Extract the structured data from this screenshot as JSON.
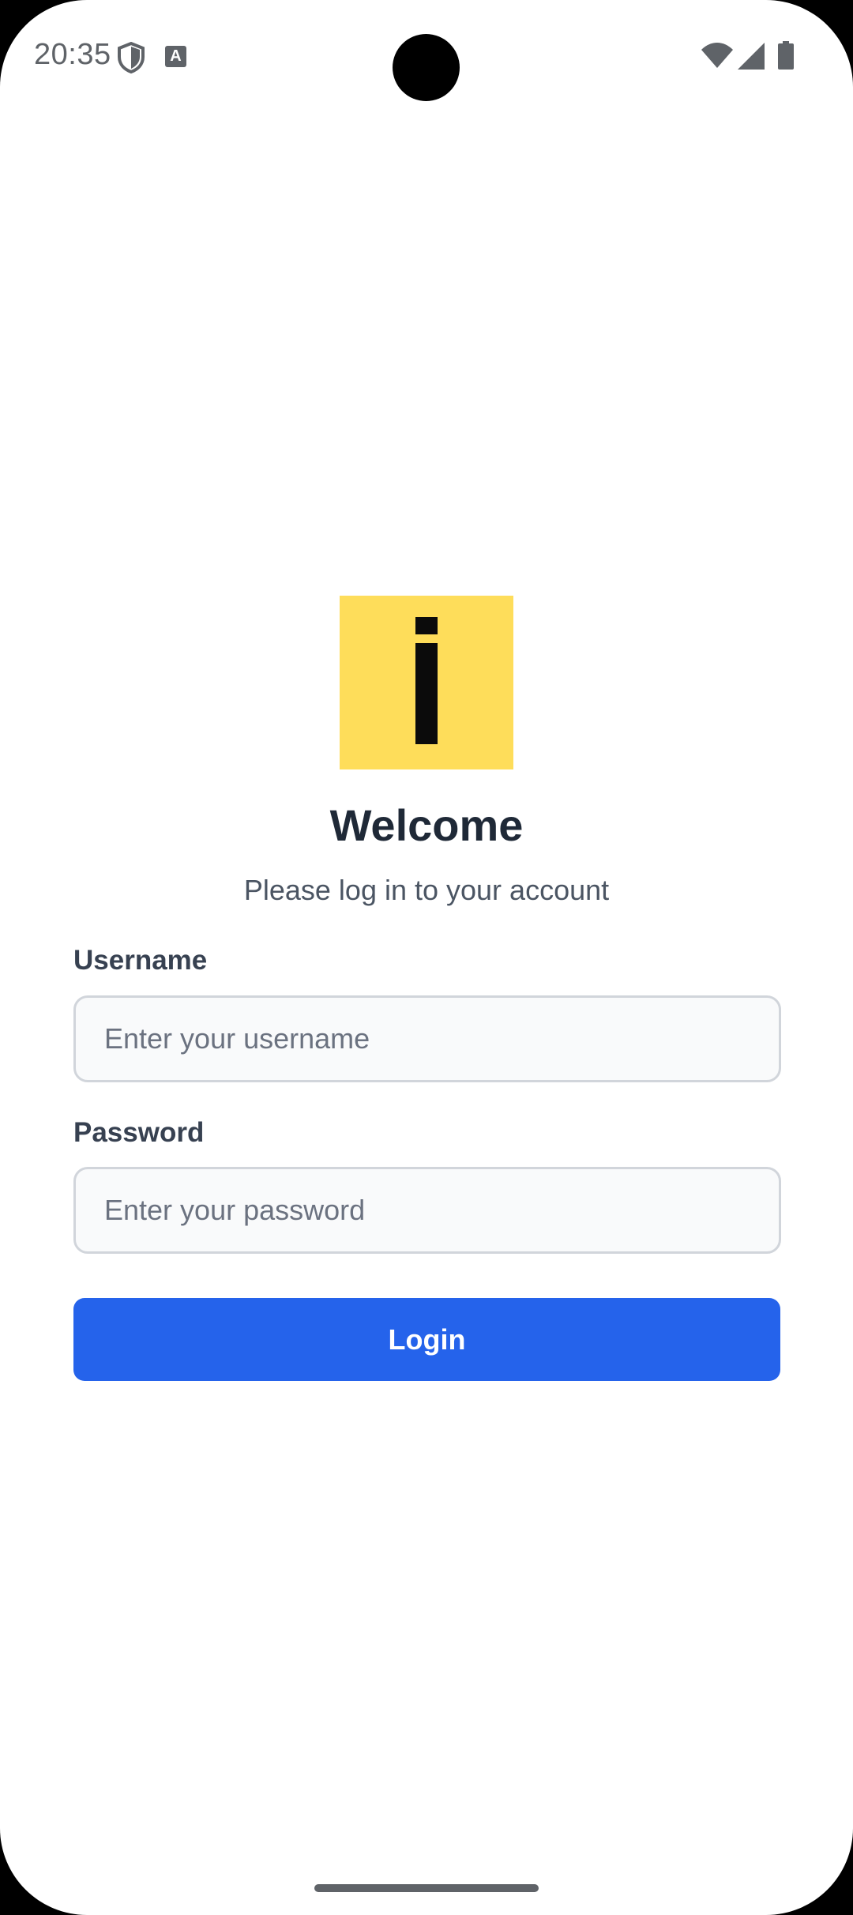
{
  "status_bar": {
    "time": "20:35",
    "icons": [
      "shield-icon",
      "keyboard-a-icon",
      "wifi-icon",
      "cellular-signal-icon",
      "battery-icon"
    ],
    "a_glyph": "A"
  },
  "logo": {
    "icon": "info-letter-i-logo",
    "background_color": "#fedd5a"
  },
  "login": {
    "title": "Welcome",
    "subtitle": "Please log in to your account",
    "username_label": "Username",
    "username_placeholder": "Enter your username",
    "username_value": "",
    "password_label": "Password",
    "password_placeholder": "Enter your password",
    "password_value": "",
    "button_label": "Login"
  },
  "colors": {
    "accent": "#2563eb",
    "title": "#1f2937",
    "logo": "#fedd5a"
  }
}
